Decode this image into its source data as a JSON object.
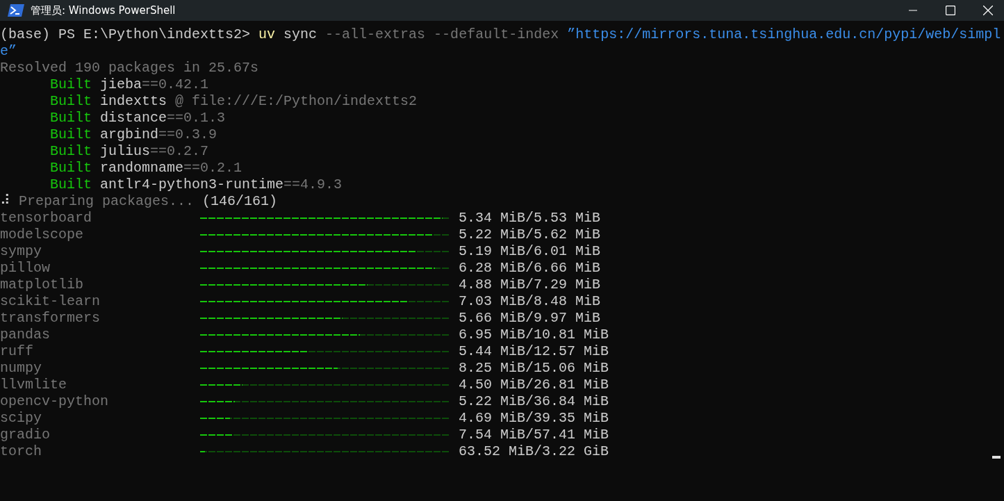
{
  "window": {
    "title": "管理员: Windows PowerShell"
  },
  "lines": [
    {
      "segments": [
        {
          "text": "(base) PS E:\\Python\\indextts2> ",
          "kind": "plain"
        },
        {
          "text": "uv",
          "kind": "command"
        },
        {
          "text": " sync ",
          "kind": "plain"
        },
        {
          "text": "--all-extras --default-index ",
          "kind": "dim"
        },
        {
          "text": "”https://mirrors.tuna.tsinghua.edu.cn/pypi/web/simpl",
          "kind": "string"
        }
      ]
    },
    {
      "segments": [
        {
          "text": "e”",
          "kind": "string"
        }
      ]
    },
    {
      "segments": [
        {
          "text": "Resolved 190 packages in 25.67s",
          "kind": "dim"
        }
      ]
    },
    {
      "segments": [
        {
          "text": "      Built ",
          "kind": "green"
        },
        {
          "text": "jieba",
          "kind": "plain"
        },
        {
          "text": "==0.42.1",
          "kind": "dim"
        }
      ]
    },
    {
      "segments": [
        {
          "text": "      Built ",
          "kind": "green"
        },
        {
          "text": "indextts ",
          "kind": "plain"
        },
        {
          "text": "@ file:///E:/Python/indextts2",
          "kind": "dim"
        }
      ]
    },
    {
      "segments": [
        {
          "text": "      Built ",
          "kind": "green"
        },
        {
          "text": "distance",
          "kind": "plain"
        },
        {
          "text": "==0.1.3",
          "kind": "dim"
        }
      ]
    },
    {
      "segments": [
        {
          "text": "      Built ",
          "kind": "green"
        },
        {
          "text": "argbind",
          "kind": "plain"
        },
        {
          "text": "==0.3.9",
          "kind": "dim"
        }
      ]
    },
    {
      "segments": [
        {
          "text": "      Built ",
          "kind": "green"
        },
        {
          "text": "julius",
          "kind": "plain"
        },
        {
          "text": "==0.2.7",
          "kind": "dim"
        }
      ]
    },
    {
      "segments": [
        {
          "text": "      Built ",
          "kind": "green"
        },
        {
          "text": "randomname",
          "kind": "plain"
        },
        {
          "text": "==0.2.1",
          "kind": "dim"
        }
      ]
    },
    {
      "segments": [
        {
          "text": "      Built ",
          "kind": "green"
        },
        {
          "text": "antlr4-python3-runtime",
          "kind": "plain"
        },
        {
          "text": "==4.9.3",
          "kind": "dim"
        }
      ]
    },
    {
      "segments": [
        {
          "text": "⠼",
          "kind": "plain"
        },
        {
          "text": " Preparing packages... ",
          "kind": "dim"
        },
        {
          "text": "(146/161)",
          "kind": "plain"
        }
      ]
    }
  ],
  "downloads": [
    {
      "name": "tensorboard",
      "level": 0.97,
      "progress": "5.34 MiB/5.53 MiB"
    },
    {
      "name": "modelscope",
      "level": 0.93,
      "progress": "5.22 MiB/5.62 MiB"
    },
    {
      "name": "sympy",
      "level": 0.86,
      "progress": "5.19 MiB/6.01 MiB"
    },
    {
      "name": "pillow",
      "level": 0.94,
      "progress": "6.28 MiB/6.66 MiB"
    },
    {
      "name": "matplotlib",
      "level": 0.67,
      "progress": "4.88 MiB/7.29 MiB"
    },
    {
      "name": "scikit-learn",
      "level": 0.83,
      "progress": "7.03 MiB/8.48 MiB"
    },
    {
      "name": "transformers",
      "level": 0.57,
      "progress": "5.66 MiB/9.97 MiB"
    },
    {
      "name": "pandas",
      "level": 0.64,
      "progress": "6.95 MiB/10.81 MiB"
    },
    {
      "name": "ruff",
      "level": 0.43,
      "progress": "5.44 MiB/12.57 MiB"
    },
    {
      "name": "numpy",
      "level": 0.55,
      "progress": "8.25 MiB/15.06 MiB"
    },
    {
      "name": "llvmlite",
      "level": 0.17,
      "progress": "4.50 MiB/26.81 MiB"
    },
    {
      "name": "opencv-python",
      "level": 0.14,
      "progress": "5.22 MiB/36.84 MiB"
    },
    {
      "name": "scipy",
      "level": 0.12,
      "progress": "4.69 MiB/39.35 MiB"
    },
    {
      "name": "gradio",
      "level": 0.13,
      "progress": "7.54 MiB/57.41 MiB"
    },
    {
      "name": "torch",
      "level": 0.02,
      "progress": "63.52 MiB/3.22 GiB"
    }
  ]
}
